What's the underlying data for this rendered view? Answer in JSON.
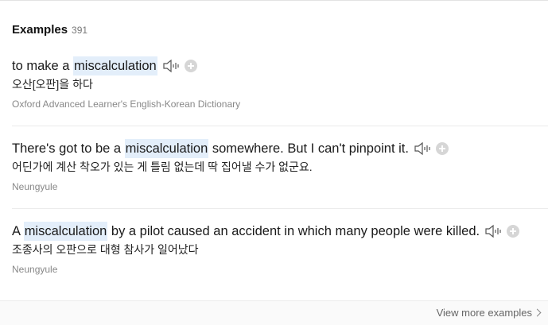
{
  "section": {
    "title": "Examples",
    "count": "391"
  },
  "examples": [
    {
      "before": "to make a ",
      "highlight": "miscalculation",
      "after": "",
      "korean": "오산[오판]을 하다",
      "source": "Oxford Advanced Learner's English-Korean Dictionary",
      "icons": [
        "speaker-icon",
        "add-icon"
      ]
    },
    {
      "before": "There's got to be a ",
      "highlight": "miscalculation",
      "after": " somewhere. But I can't pinpoint it.",
      "korean": "어딘가에 계산 착오가 있는 게 틀림 없는데 딱 집어낼 수가 없군요.",
      "source": "Neungyule",
      "icons": [
        "speaker-icon",
        "add-icon"
      ]
    },
    {
      "before": "A ",
      "highlight": "miscalculation",
      "after": " by a pilot caused an accident in which many people were killed.",
      "korean": "조종사의 오판으로 대형 참사가 일어났다",
      "source": "Neungyule",
      "icons": [
        "speaker-icon",
        "add-icon"
      ]
    }
  ],
  "footer": {
    "view_more_label": "View more examples"
  },
  "colors": {
    "highlight": "#e3eefa",
    "add_button": "#d6d6d6",
    "source_text": "#888888"
  }
}
